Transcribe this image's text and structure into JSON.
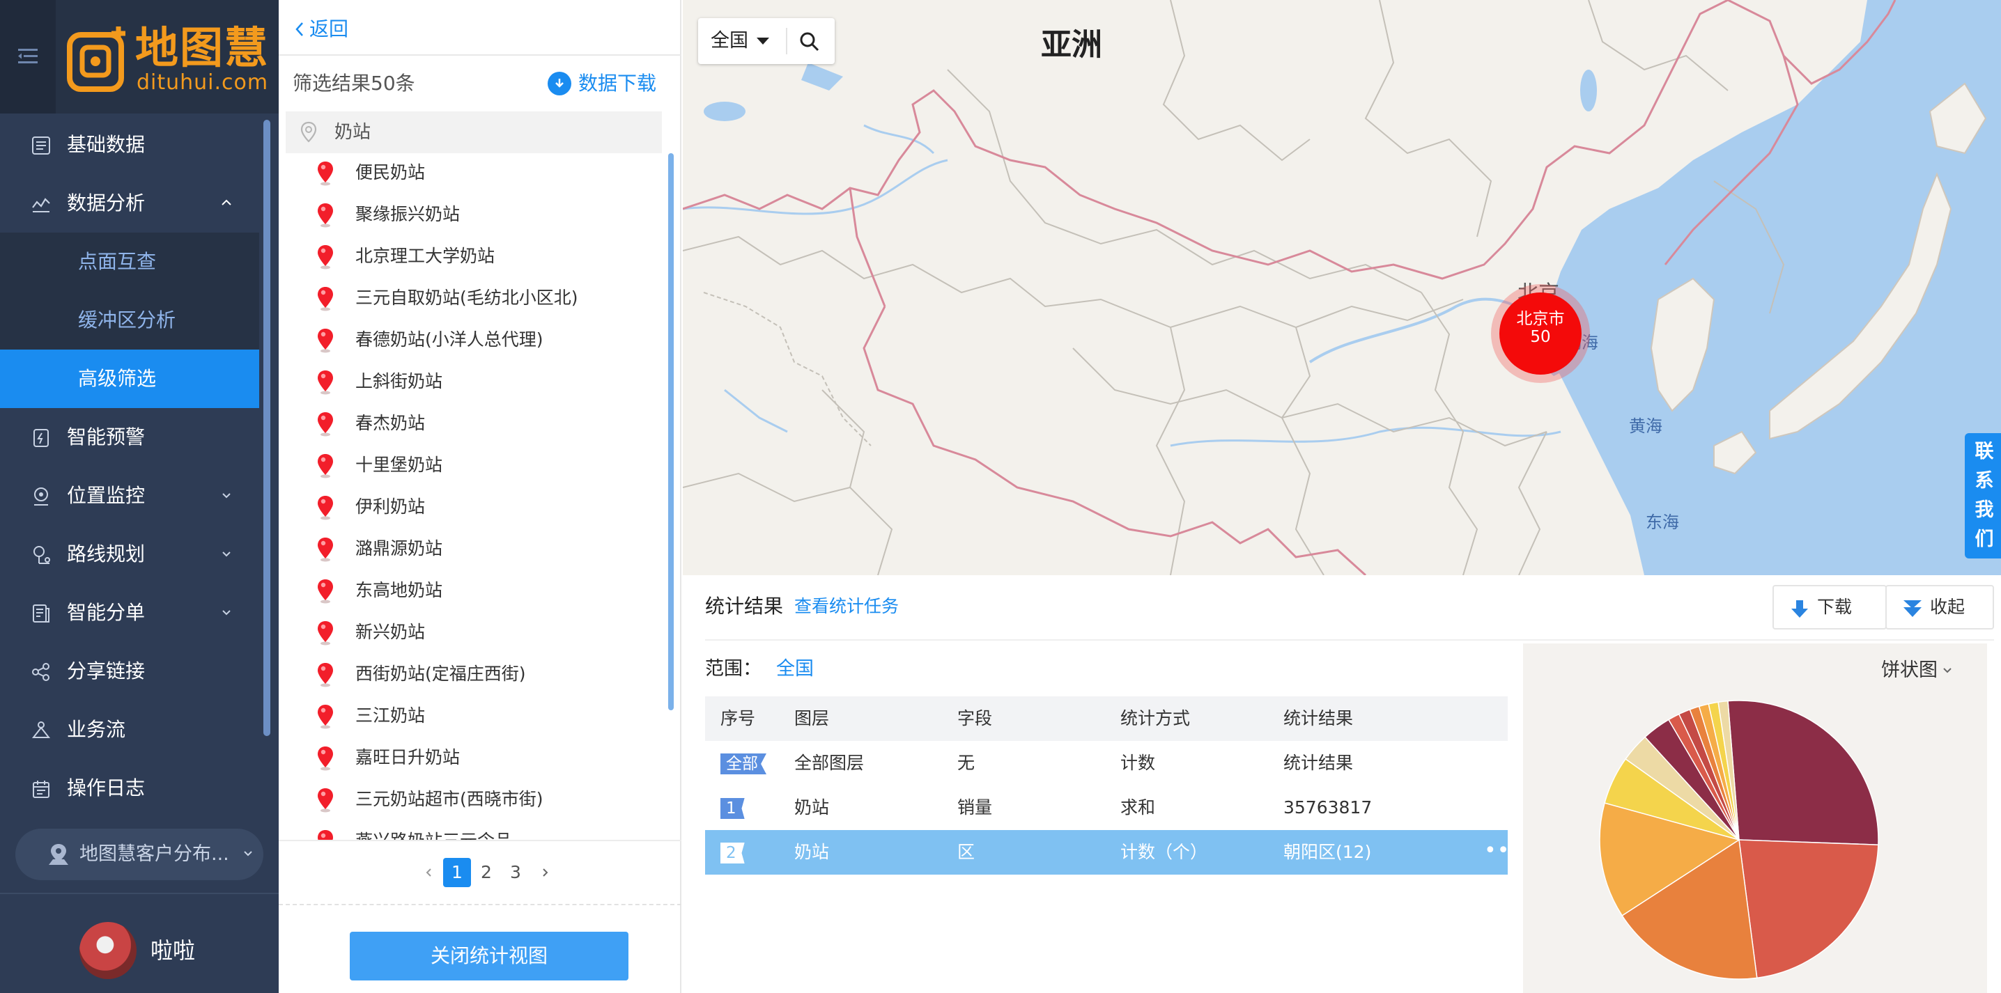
{
  "sidebar": {
    "logo_cn": "地图慧",
    "logo_en": "dituhui.com",
    "items": [
      {
        "label": "基础数据",
        "icon": "database-icon"
      },
      {
        "label": "数据分析",
        "icon": "analysis-icon",
        "expanded": true
      },
      {
        "label": "智能预警",
        "icon": "alert-icon"
      },
      {
        "label": "位置监控",
        "icon": "location-icon"
      },
      {
        "label": "路线规划",
        "icon": "route-icon"
      },
      {
        "label": "智能分单",
        "icon": "dispatch-icon"
      },
      {
        "label": "分享链接",
        "icon": "share-icon"
      },
      {
        "label": "业务流",
        "icon": "workflow-icon"
      },
      {
        "label": "操作日志",
        "icon": "calendar-icon"
      }
    ],
    "sub_items": [
      {
        "label": "点面互查"
      },
      {
        "label": "缓冲区分析"
      },
      {
        "label": "高级筛选",
        "active": true
      }
    ],
    "client_select": "地图慧客户分布...",
    "username": "啦啦"
  },
  "list_panel": {
    "back_label": "返回",
    "result_count": "筛选结果50条",
    "download_label": "数据下载",
    "group_label": "奶站",
    "items": [
      "便民奶站",
      "聚缘振兴奶站",
      "北京理工大学奶站",
      "三元自取奶站(毛纺北小区北)",
      "春德奶站(小洋人总代理)",
      "上斜街奶站",
      "春杰奶站",
      "十里堡奶站",
      "伊利奶站",
      "潞鼎源奶站",
      "东高地奶站",
      "新兴奶站",
      "西街奶站(定福庄西街)",
      "三江奶站",
      "嘉旺日升奶站",
      "三元奶站超市(西晓市街)",
      "燕兴路奶站三元令品"
    ],
    "pages": [
      "1",
      "2",
      "3"
    ],
    "current_page": "1",
    "close_button": "关闭统计视图"
  },
  "map": {
    "region": "全国",
    "continent_label": "亚洲",
    "labels": {
      "beijing": "北京",
      "bohai": "渤海",
      "yellow_sea": "黄海",
      "east_sea": "东海"
    },
    "cluster": {
      "name": "北京市",
      "count": "50"
    },
    "contact_tab": "联系我们"
  },
  "stats": {
    "title": "统计结果",
    "task_link": "查看统计任务",
    "download_btn": "下载",
    "collapse_btn": "收起",
    "scope_label": "范围：",
    "scope_value": "全国",
    "columns": [
      "序号",
      "图层",
      "字段",
      "统计方式",
      "统计结果"
    ],
    "rows": [
      {
        "index": "全部",
        "layer": "全部图层",
        "field": "无",
        "method": "计数",
        "result": "统计结果"
      },
      {
        "index": "1",
        "layer": "奶站",
        "field": "销量",
        "method": "求和",
        "result": "35763817"
      },
      {
        "index": "2",
        "layer": "奶站",
        "field": "区",
        "method": "计数（个）",
        "result": "朝阳区(12)",
        "selected": true
      }
    ],
    "chart_type": "饼状图"
  },
  "colors": {
    "accent": "#1a8cf0",
    "sidebar_bg": "#2e3c55",
    "logo_orange": "#f39a1d",
    "cluster_red": "#f40a0a",
    "selected_row": "#7fc1f2"
  },
  "chart_data": {
    "type": "pie",
    "title": "",
    "slices": [
      {
        "value": 12,
        "color": "#8c2d47"
      },
      {
        "value": 10,
        "color": "#d95a4a"
      },
      {
        "value": 8,
        "color": "#e8813d"
      },
      {
        "value": 6,
        "color": "#f5ac47"
      },
      {
        "value": 2.5,
        "color": "#f4d44c"
      },
      {
        "value": 1.5,
        "color": "#eddaa5"
      },
      {
        "value": 1.5,
        "color": "#8c2d47"
      },
      {
        "value": 0.6,
        "color": "#d95a4a"
      },
      {
        "value": 0.6,
        "color": "#c44a45"
      },
      {
        "value": 0.5,
        "color": "#e8813d"
      },
      {
        "value": 0.5,
        "color": "#f5ac47"
      },
      {
        "value": 0.5,
        "color": "#f4d44c"
      },
      {
        "value": 0.5,
        "color": "#eddaa5"
      }
    ]
  }
}
